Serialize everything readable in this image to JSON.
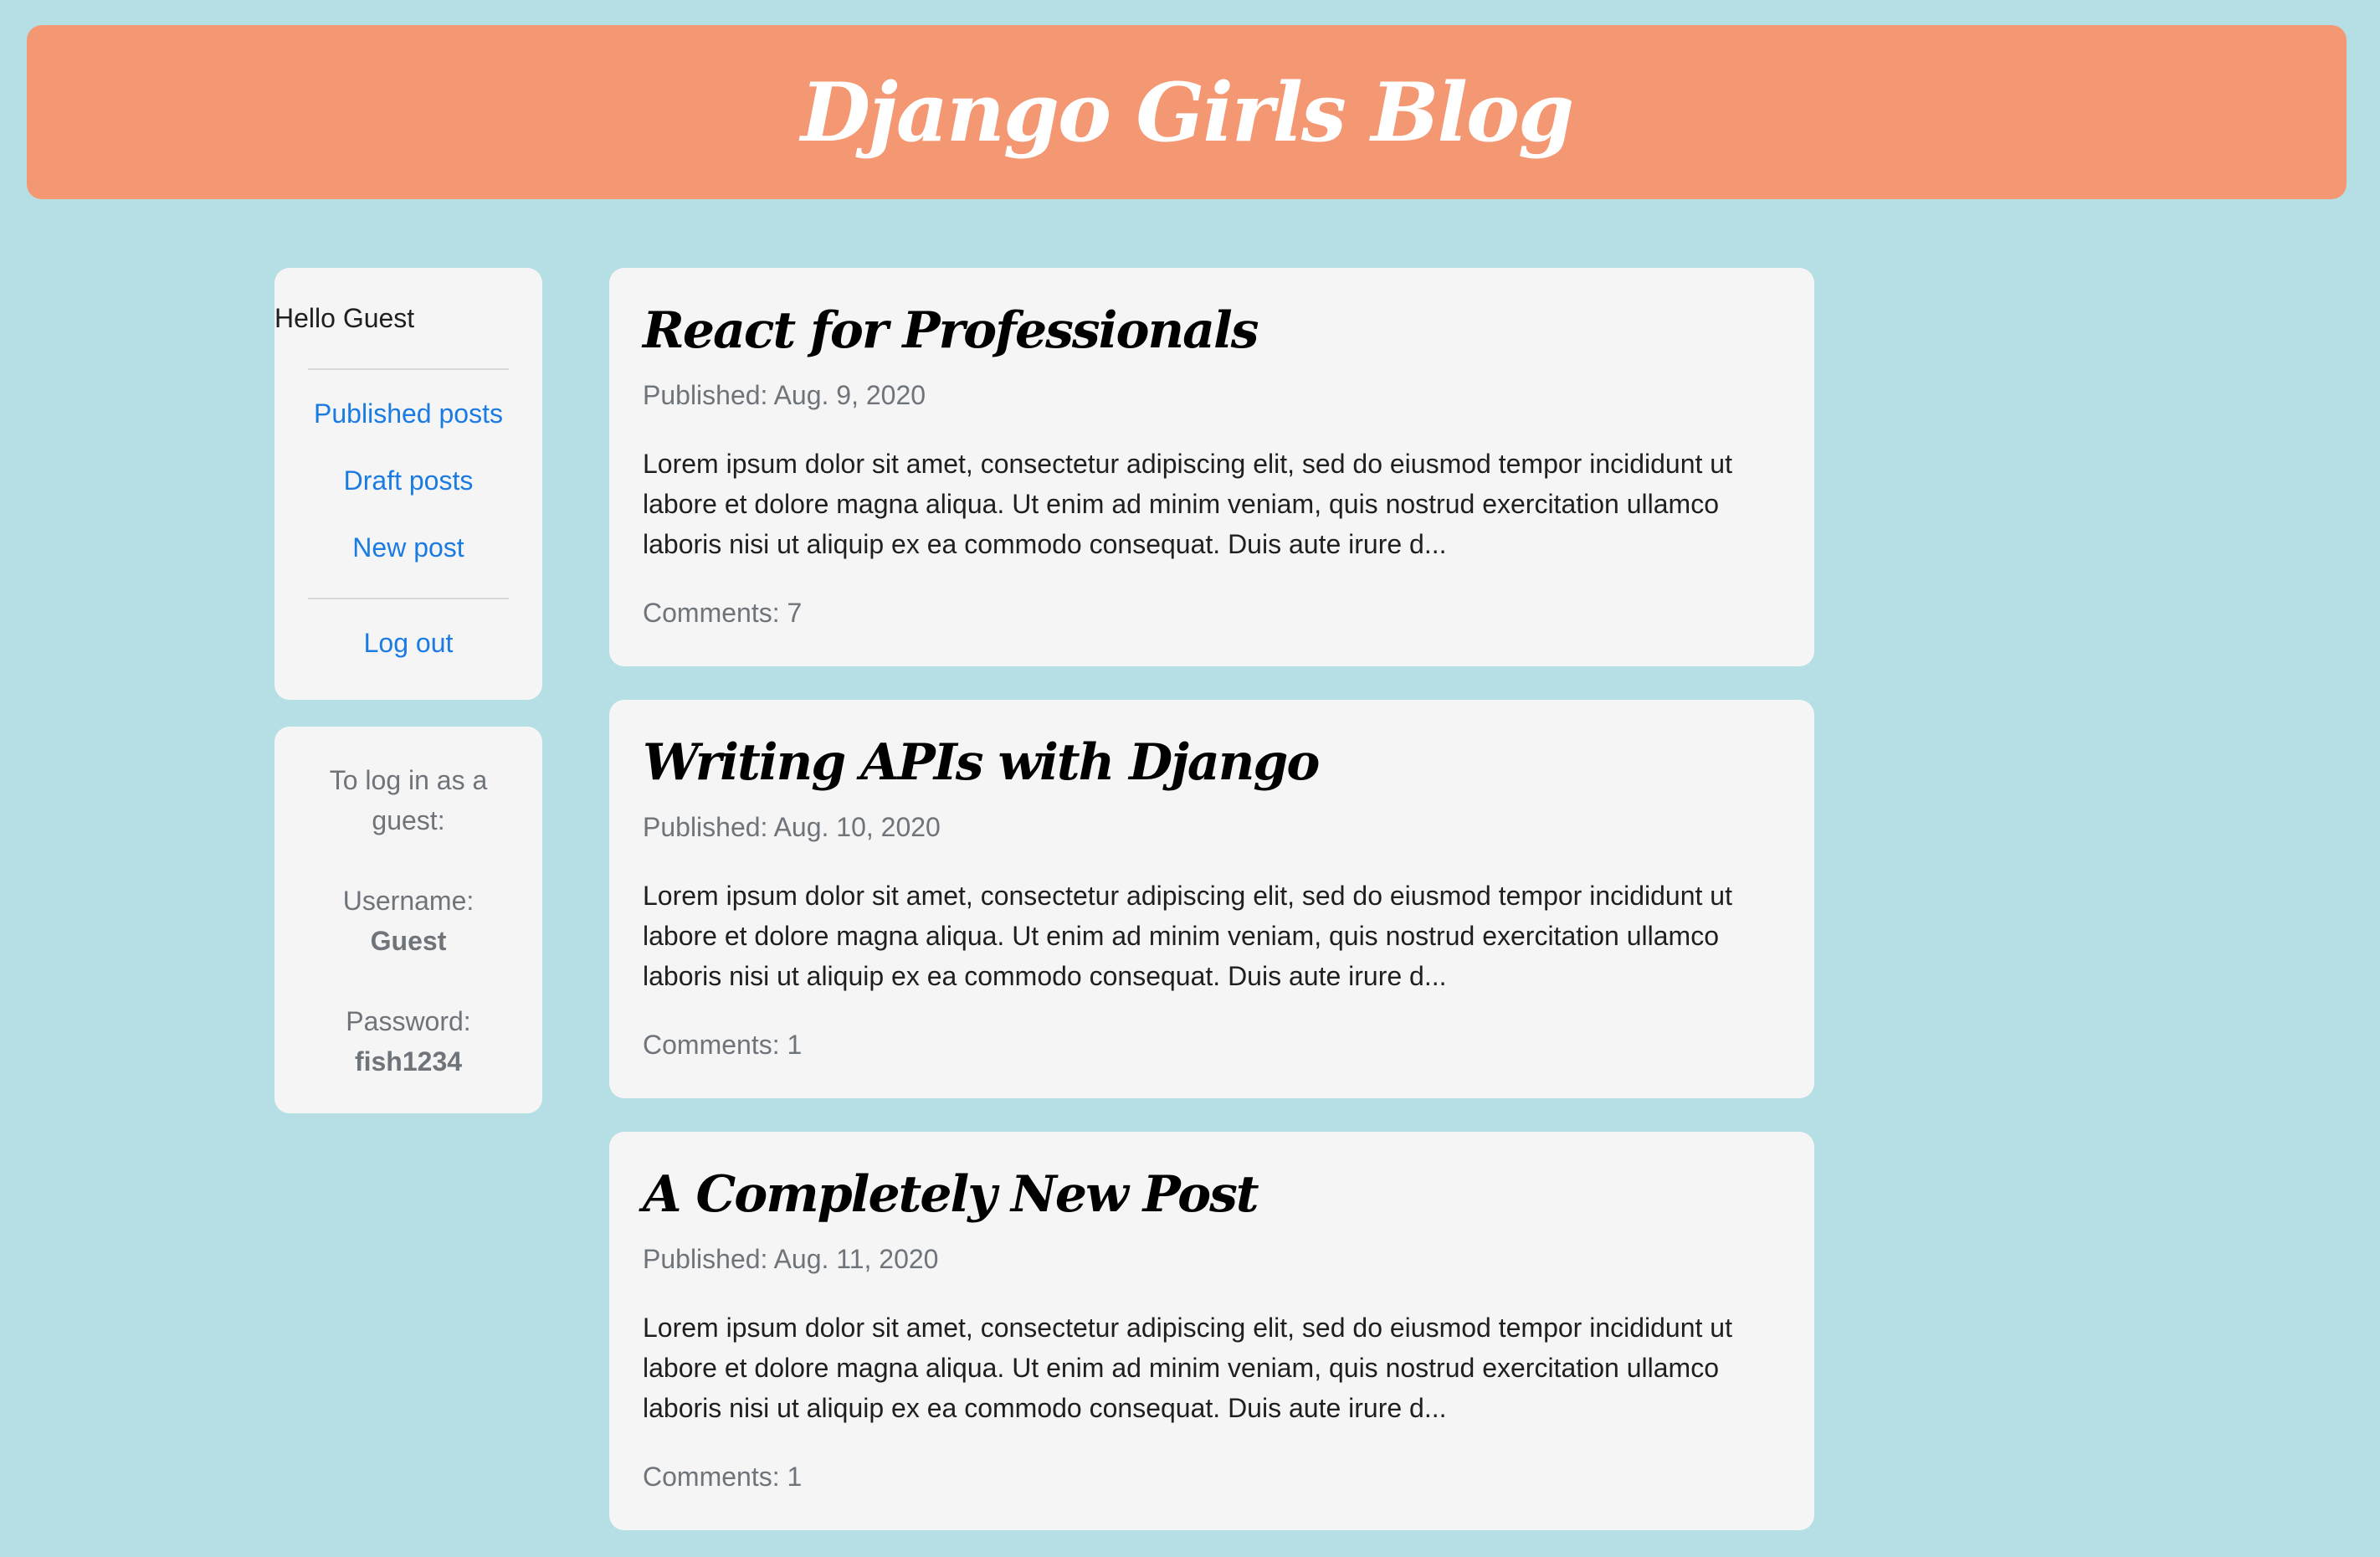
{
  "header": {
    "title": "Django Girls Blog"
  },
  "sidebar": {
    "greeting": "Hello Guest",
    "links": {
      "published": "Published posts",
      "drafts": "Draft posts",
      "new_post": "New post",
      "logout": "Log out"
    },
    "guest_info": {
      "intro_line1": "To log in as a",
      "intro_line2": "guest:",
      "username_label": "Username:",
      "username": "Guest",
      "password_label": "Password:",
      "password": "fish1234"
    }
  },
  "posts": [
    {
      "title": "React for Professionals",
      "published": "Published: Aug. 9, 2020",
      "excerpt": "Lorem ipsum dolor sit amet, consectetur adipiscing elit, sed do eiusmod tempor incididunt ut labore et dolore magna aliqua. Ut enim ad minim veniam, quis nostrud exercitation ullamco laboris nisi ut aliquip ex ea commodo consequat. Duis aute irure d...",
      "comments": "Comments: 7"
    },
    {
      "title": "Writing APIs with Django",
      "published": "Published: Aug. 10, 2020",
      "excerpt": "Lorem ipsum dolor sit amet, consectetur adipiscing elit, sed do eiusmod tempor incididunt ut labore et dolore magna aliqua. Ut enim ad minim veniam, quis nostrud exercitation ullamco laboris nisi ut aliquip ex ea commodo consequat. Duis aute irure d...",
      "comments": "Comments: 1"
    },
    {
      "title": "A Completely New Post",
      "published": "Published: Aug. 11, 2020",
      "excerpt": "Lorem ipsum dolor sit amet, consectetur adipiscing elit, sed do eiusmod tempor incididunt ut labore et dolore magna aliqua. Ut enim ad minim veniam, quis nostrud exercitation ullamco laboris nisi ut aliquip ex ea commodo consequat. Duis aute irure d...",
      "comments": "Comments: 1"
    }
  ],
  "colors": {
    "background": "#b5dfe4",
    "header": "#f49874",
    "card": "#f5f5f5",
    "link": "#1a7be3",
    "muted": "#6e7479"
  }
}
